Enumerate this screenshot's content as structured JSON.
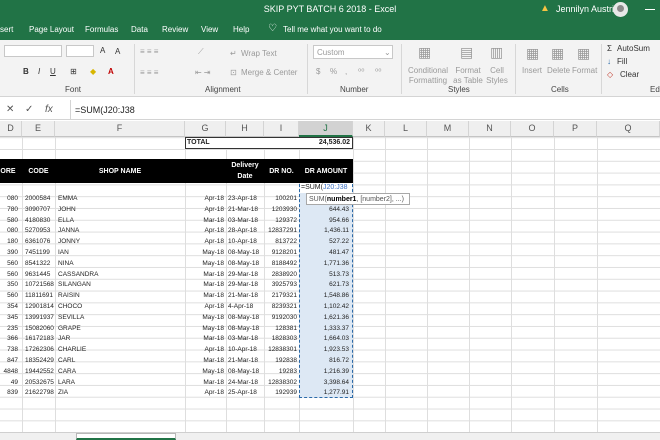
{
  "title": "SKIP PYT BATCH 6 2018 - Excel",
  "user": "Jennilyn Austria",
  "tabs": [
    "sert",
    "Page Layout",
    "Formulas",
    "Data",
    "Review",
    "View",
    "Help"
  ],
  "tell_me": "Tell me what you want to do",
  "ribbon": {
    "font_label": "Font",
    "alignment_label": "Alignment",
    "number_label": "Number",
    "styles_label": "Styles",
    "cells_label": "Cells",
    "editing_label": "Edi",
    "wrap_text": "Wrap Text",
    "merge_center": "Merge & Center",
    "number_format": "Custom",
    "currency": "$",
    "percent": "%",
    "comma": ",",
    "conditional_formatting": "Conditional Formatting",
    "format_as_table": "Format as Table",
    "cell_styles": "Cell Styles",
    "insert": "Insert",
    "delete": "Delete",
    "format": "Format",
    "autosum": "AutoSum",
    "fill": "Fill",
    "clear": "Clear"
  },
  "formula_bar": {
    "cancel": "✕",
    "enter": "✓",
    "fx": "fx",
    "formula": "=SUM(J20:J38"
  },
  "columns": [
    "D",
    "E",
    "F",
    "G",
    "H",
    "I",
    "J",
    "K",
    "L",
    "M",
    "N",
    "O",
    "P",
    "Q"
  ],
  "total_label": "TOTAL",
  "total_value": "24,536.02",
  "headers": {
    "store": "ORE",
    "code": "CODE",
    "shop": "SHOP NAME",
    "delivery": "Delivery",
    "date": "Date",
    "dr_no": "DR NO.",
    "dr_amount": "DR AMOUNT"
  },
  "edit_cell": {
    "prefix": "=SUM(",
    "ref": "J20:J38"
  },
  "tooltip": {
    "fn": "SUM(",
    "arg1": "number1",
    ", rest": ", [number2], ...)"
  },
  "rows": [
    {
      "d": "080",
      "code": "2000584",
      "shop": "EMMA",
      "g": "Apr-18",
      "date": "23-Apr-18",
      "dr": "100201",
      "amt": ""
    },
    {
      "d": "780",
      "code": "3090707",
      "shop": "JOHN",
      "g": "Apr-18",
      "date": "21-Mar-18",
      "dr": "1203930",
      "amt": "644.43"
    },
    {
      "d": "580",
      "code": "4180830",
      "shop": "ELLA",
      "g": "Mar-18",
      "date": "03-Mar-18",
      "dr": "129372",
      "amt": "954.66"
    },
    {
      "d": "080",
      "code": "5270953",
      "shop": "JANNA",
      "g": "Apr-18",
      "date": "28-Apr-18",
      "dr": "12837291",
      "amt": "1,436.11"
    },
    {
      "d": "180",
      "code": "6361076",
      "shop": "JONNY",
      "g": "Apr-18",
      "date": "10-Apr-18",
      "dr": "813722",
      "amt": "527.22"
    },
    {
      "d": "390",
      "code": "7451199",
      "shop": "IAN",
      "g": "May-18",
      "date": "08-May-18",
      "dr": "9128201",
      "amt": "481.47"
    },
    {
      "d": "560",
      "code": "8541322",
      "shop": "NINA",
      "g": "May-18",
      "date": "08-May-18",
      "dr": "8188492",
      "amt": "1,771.36"
    },
    {
      "d": "560",
      "code": "9631445",
      "shop": "CASSANDRA",
      "g": "Mar-18",
      "date": "29-Mar-18",
      "dr": "2838920",
      "amt": "513.73"
    },
    {
      "d": "350",
      "code": "10721568",
      "shop": "SILANGAN",
      "g": "Mar-18",
      "date": "29-Mar-18",
      "dr": "3925793",
      "amt": "621.73"
    },
    {
      "d": "560",
      "code": "11811691",
      "shop": "RAISIN",
      "g": "Mar-18",
      "date": "21-Mar-18",
      "dr": "2179321",
      "amt": "1,548.86"
    },
    {
      "d": "354",
      "code": "12901814",
      "shop": "CHOCO",
      "g": "Apr-18",
      "date": "4-Apr-18",
      "dr": "8239321",
      "amt": "1,102.42"
    },
    {
      "d": "345",
      "code": "13991937",
      "shop": "SEVILLA",
      "g": "May-18",
      "date": "08-May-18",
      "dr": "9192030",
      "amt": "1,621.36"
    },
    {
      "d": "235",
      "code": "15082060",
      "shop": "GRAPE",
      "g": "May-18",
      "date": "08-May-18",
      "dr": "128381",
      "amt": "1,333.37"
    },
    {
      "d": "366",
      "code": "16172183",
      "shop": "JAR",
      "g": "Mar-18",
      "date": "03-Mar-18",
      "dr": "1828303",
      "amt": "1,664.03"
    },
    {
      "d": "738",
      "code": "17262306",
      "shop": "CHARLIE",
      "g": "Apr-18",
      "date": "10-Apr-18",
      "dr": "12838301",
      "amt": "1,923.53"
    },
    {
      "d": "847",
      "code": "18352429",
      "shop": "CARL",
      "g": "Mar-18",
      "date": "21-Mar-18",
      "dr": "192838",
      "amt": "816.72"
    },
    {
      "d": "4848",
      "code": "19442552",
      "shop": "CARA",
      "g": "May-18",
      "date": "08-May-18",
      "dr": "19283",
      "amt": "1,216.39"
    },
    {
      "d": "49",
      "code": "20532675",
      "shop": "LARA",
      "g": "Mar-18",
      "date": "24-Mar-18",
      "dr": "12838302",
      "amt": "3,398.64"
    },
    {
      "d": "839",
      "code": "21622798",
      "shop": "ZIA",
      "g": "Apr-18",
      "date": "25-Apr-18",
      "dr": "192939",
      "amt": "1,277.91"
    }
  ]
}
